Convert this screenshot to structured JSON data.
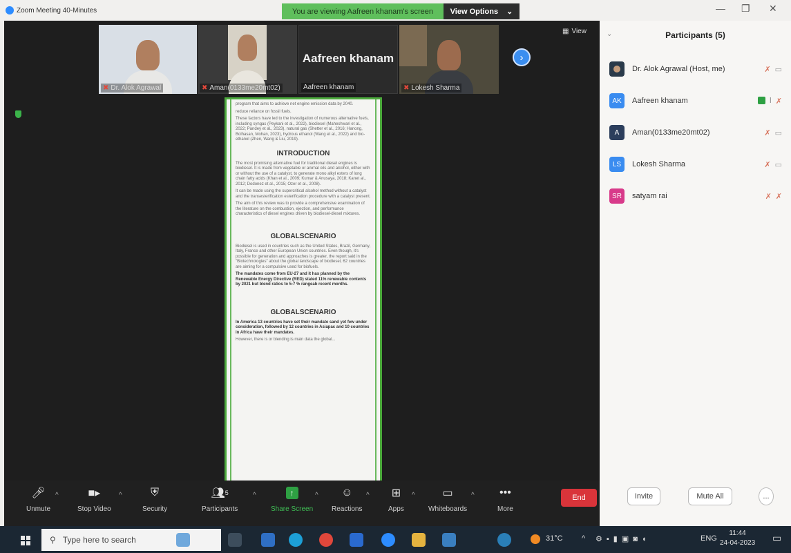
{
  "window": {
    "title": "Zoom Meeting 40-Minutes",
    "viewing_banner": "You are viewing Aafreen khanam's screen",
    "view_options_label": "View Options",
    "minimize": "—",
    "restore": "❐",
    "close": "✕"
  },
  "video_strip": {
    "view_label": "View",
    "tiles": [
      {
        "name": "Dr. Alok Agrawal",
        "muted": true
      },
      {
        "name": "Aman(0133me20mt02)",
        "muted": true
      },
      {
        "name": "Aafreen khanam",
        "display_name": "Aafreen khanam",
        "muted": false
      },
      {
        "name": "Lokesh Sharma",
        "muted": true
      }
    ],
    "next_symbol": "›"
  },
  "shared_doc": {
    "intro_fragment": [
      "program that aims to achieve net engine emission data by 2040.",
      "reduce reliance on fossil fuels.",
      "These factors have led to the investigation of numerous alternative fuels, including syngas (Peykani et al., 2022), biodiesel (Maheshwari et al., 2022; Pandey et al., 2023), natural gas (Shetter et al., 2016; Hanong, Bolhasan, Mohan, 2023), hydrous ethanol (Wang et al., 2022) and bio-ethanol (Zhen, Wang & Liu, 2019)."
    ],
    "intro_heading": "INTRODUCTION",
    "intro_points": [
      "The most promising alternative fuel for traditional diesel engines is biodiesel. It is made from vegetable or animal oils and alcohol, either with or without the use of a catalyst, to generate mono alkyl esters of long chain fatty acids (Khan et al., 2009; Kumar & Anusaya, 2018; Kanet al., 2012; Dodonez et al., 2015; Ozer et al., 2008).",
      "It can be made using the supercritical alcohol method without a catalyst and the transesterification esterification procedure with a catalyst present.",
      "The aim of this review was to provide a comprehensive examination of the literature on the combustion, ejection, and performance characteristics of diesel engines driven by biodiesel-diesel mixtures."
    ],
    "global_heading_1": "GLOBALSCENARIO",
    "global_points_1": [
      "Biodiesel is used in countries such as the United States, Brazil, Germany, Italy, France and other European Union countries. Even though, it's possible for generation and approaches is greater, the report said in the \"Biotechnologies\" about the global landscape of biodiesel, 62 countries are aiming for a compulsive used for biofuels.",
      "The mandates come from EU-27 and it has planned by the Renewable Energy Directive (RED) stated 11% renewable contents by 2021 but blend ratios to 5-7 % rangeab recent months."
    ],
    "global_heading_2": "GLOBALSCENARIO",
    "global_points_2": [
      "In America 13 countries have set their mandate sand yet few under consideration, followed by 12 countries in Asiapac and 10 countries in Africa have their mandates.",
      "However, there is or blending is main data the global..."
    ]
  },
  "toolbar": {
    "unmute": "Unmute",
    "stop_video": "Stop Video",
    "security": "Security",
    "participants": "Participants",
    "participants_count": "5",
    "share_screen": "Share Screen",
    "reactions": "Reactions",
    "apps": "Apps",
    "whiteboards": "Whiteboards",
    "more": "More",
    "end": "End"
  },
  "participants_panel": {
    "title": "Participants (5)",
    "invite": "Invite",
    "mute_all": "Mute All",
    "more": "...",
    "list": [
      {
        "initials": "",
        "name": "Dr. Alok Agrawal (Host, me)",
        "color": "#2a3a4a"
      },
      {
        "initials": "AK",
        "name": "Aafreen khanam",
        "color": "#3a8cf0"
      },
      {
        "initials": "A",
        "name": "Aman(0133me20mt02)",
        "color": "#2c3e5c"
      },
      {
        "initials": "LS",
        "name": "Lokesh Sharma",
        "color": "#3a8cf0"
      },
      {
        "initials": "SR",
        "name": "satyam rai",
        "color": "#d83a8a"
      }
    ]
  },
  "taskbar": {
    "search_placeholder": "Type here to search",
    "temperature": "31°C",
    "language": "ENG",
    "time": "11:44",
    "date": "24-04-2023"
  },
  "colors": {
    "banner_green": "#5fbf5c",
    "end_red": "#d9343a",
    "zoom_blue": "#2d8cff",
    "share_green": "#2ea043"
  }
}
